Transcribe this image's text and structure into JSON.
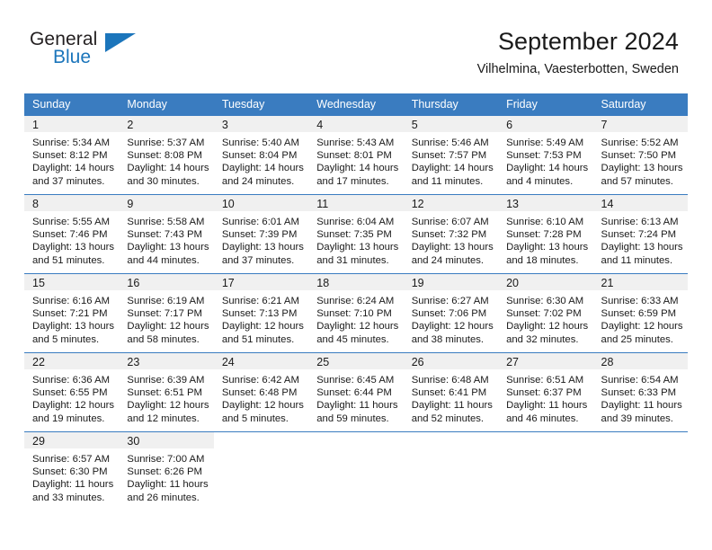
{
  "brand": {
    "name_part1": "General",
    "name_part2": "Blue",
    "logo_icon": "triangle-flag-icon",
    "accent_color": "#1b75bb"
  },
  "header": {
    "month_title": "September 2024",
    "location": "Vilhelmina, Vaesterbotten, Sweden"
  },
  "calendar": {
    "header_bg": "#3a7cc0",
    "daynum_bg": "#f0f0f0",
    "weekday_headers": [
      "Sunday",
      "Monday",
      "Tuesday",
      "Wednesday",
      "Thursday",
      "Friday",
      "Saturday"
    ],
    "weeks": [
      [
        {
          "day": "1",
          "sunrise": "Sunrise: 5:34 AM",
          "sunset": "Sunset: 8:12 PM",
          "daylight_line1": "Daylight: 14 hours",
          "daylight_line2": "and 37 minutes."
        },
        {
          "day": "2",
          "sunrise": "Sunrise: 5:37 AM",
          "sunset": "Sunset: 8:08 PM",
          "daylight_line1": "Daylight: 14 hours",
          "daylight_line2": "and 30 minutes."
        },
        {
          "day": "3",
          "sunrise": "Sunrise: 5:40 AM",
          "sunset": "Sunset: 8:04 PM",
          "daylight_line1": "Daylight: 14 hours",
          "daylight_line2": "and 24 minutes."
        },
        {
          "day": "4",
          "sunrise": "Sunrise: 5:43 AM",
          "sunset": "Sunset: 8:01 PM",
          "daylight_line1": "Daylight: 14 hours",
          "daylight_line2": "and 17 minutes."
        },
        {
          "day": "5",
          "sunrise": "Sunrise: 5:46 AM",
          "sunset": "Sunset: 7:57 PM",
          "daylight_line1": "Daylight: 14 hours",
          "daylight_line2": "and 11 minutes."
        },
        {
          "day": "6",
          "sunrise": "Sunrise: 5:49 AM",
          "sunset": "Sunset: 7:53 PM",
          "daylight_line1": "Daylight: 14 hours",
          "daylight_line2": "and 4 minutes."
        },
        {
          "day": "7",
          "sunrise": "Sunrise: 5:52 AM",
          "sunset": "Sunset: 7:50 PM",
          "daylight_line1": "Daylight: 13 hours",
          "daylight_line2": "and 57 minutes."
        }
      ],
      [
        {
          "day": "8",
          "sunrise": "Sunrise: 5:55 AM",
          "sunset": "Sunset: 7:46 PM",
          "daylight_line1": "Daylight: 13 hours",
          "daylight_line2": "and 51 minutes."
        },
        {
          "day": "9",
          "sunrise": "Sunrise: 5:58 AM",
          "sunset": "Sunset: 7:43 PM",
          "daylight_line1": "Daylight: 13 hours",
          "daylight_line2": "and 44 minutes."
        },
        {
          "day": "10",
          "sunrise": "Sunrise: 6:01 AM",
          "sunset": "Sunset: 7:39 PM",
          "daylight_line1": "Daylight: 13 hours",
          "daylight_line2": "and 37 minutes."
        },
        {
          "day": "11",
          "sunrise": "Sunrise: 6:04 AM",
          "sunset": "Sunset: 7:35 PM",
          "daylight_line1": "Daylight: 13 hours",
          "daylight_line2": "and 31 minutes."
        },
        {
          "day": "12",
          "sunrise": "Sunrise: 6:07 AM",
          "sunset": "Sunset: 7:32 PM",
          "daylight_line1": "Daylight: 13 hours",
          "daylight_line2": "and 24 minutes."
        },
        {
          "day": "13",
          "sunrise": "Sunrise: 6:10 AM",
          "sunset": "Sunset: 7:28 PM",
          "daylight_line1": "Daylight: 13 hours",
          "daylight_line2": "and 18 minutes."
        },
        {
          "day": "14",
          "sunrise": "Sunrise: 6:13 AM",
          "sunset": "Sunset: 7:24 PM",
          "daylight_line1": "Daylight: 13 hours",
          "daylight_line2": "and 11 minutes."
        }
      ],
      [
        {
          "day": "15",
          "sunrise": "Sunrise: 6:16 AM",
          "sunset": "Sunset: 7:21 PM",
          "daylight_line1": "Daylight: 13 hours",
          "daylight_line2": "and 5 minutes."
        },
        {
          "day": "16",
          "sunrise": "Sunrise: 6:19 AM",
          "sunset": "Sunset: 7:17 PM",
          "daylight_line1": "Daylight: 12 hours",
          "daylight_line2": "and 58 minutes."
        },
        {
          "day": "17",
          "sunrise": "Sunrise: 6:21 AM",
          "sunset": "Sunset: 7:13 PM",
          "daylight_line1": "Daylight: 12 hours",
          "daylight_line2": "and 51 minutes."
        },
        {
          "day": "18",
          "sunrise": "Sunrise: 6:24 AM",
          "sunset": "Sunset: 7:10 PM",
          "daylight_line1": "Daylight: 12 hours",
          "daylight_line2": "and 45 minutes."
        },
        {
          "day": "19",
          "sunrise": "Sunrise: 6:27 AM",
          "sunset": "Sunset: 7:06 PM",
          "daylight_line1": "Daylight: 12 hours",
          "daylight_line2": "and 38 minutes."
        },
        {
          "day": "20",
          "sunrise": "Sunrise: 6:30 AM",
          "sunset": "Sunset: 7:02 PM",
          "daylight_line1": "Daylight: 12 hours",
          "daylight_line2": "and 32 minutes."
        },
        {
          "day": "21",
          "sunrise": "Sunrise: 6:33 AM",
          "sunset": "Sunset: 6:59 PM",
          "daylight_line1": "Daylight: 12 hours",
          "daylight_line2": "and 25 minutes."
        }
      ],
      [
        {
          "day": "22",
          "sunrise": "Sunrise: 6:36 AM",
          "sunset": "Sunset: 6:55 PM",
          "daylight_line1": "Daylight: 12 hours",
          "daylight_line2": "and 19 minutes."
        },
        {
          "day": "23",
          "sunrise": "Sunrise: 6:39 AM",
          "sunset": "Sunset: 6:51 PM",
          "daylight_line1": "Daylight: 12 hours",
          "daylight_line2": "and 12 minutes."
        },
        {
          "day": "24",
          "sunrise": "Sunrise: 6:42 AM",
          "sunset": "Sunset: 6:48 PM",
          "daylight_line1": "Daylight: 12 hours",
          "daylight_line2": "and 5 minutes."
        },
        {
          "day": "25",
          "sunrise": "Sunrise: 6:45 AM",
          "sunset": "Sunset: 6:44 PM",
          "daylight_line1": "Daylight: 11 hours",
          "daylight_line2": "and 59 minutes."
        },
        {
          "day": "26",
          "sunrise": "Sunrise: 6:48 AM",
          "sunset": "Sunset: 6:41 PM",
          "daylight_line1": "Daylight: 11 hours",
          "daylight_line2": "and 52 minutes."
        },
        {
          "day": "27",
          "sunrise": "Sunrise: 6:51 AM",
          "sunset": "Sunset: 6:37 PM",
          "daylight_line1": "Daylight: 11 hours",
          "daylight_line2": "and 46 minutes."
        },
        {
          "day": "28",
          "sunrise": "Sunrise: 6:54 AM",
          "sunset": "Sunset: 6:33 PM",
          "daylight_line1": "Daylight: 11 hours",
          "daylight_line2": "and 39 minutes."
        }
      ],
      [
        {
          "day": "29",
          "sunrise": "Sunrise: 6:57 AM",
          "sunset": "Sunset: 6:30 PM",
          "daylight_line1": "Daylight: 11 hours",
          "daylight_line2": "and 33 minutes."
        },
        {
          "day": "30",
          "sunrise": "Sunrise: 7:00 AM",
          "sunset": "Sunset: 6:26 PM",
          "daylight_line1": "Daylight: 11 hours",
          "daylight_line2": "and 26 minutes."
        },
        {
          "day": "",
          "sunrise": "",
          "sunset": "",
          "daylight_line1": "",
          "daylight_line2": ""
        },
        {
          "day": "",
          "sunrise": "",
          "sunset": "",
          "daylight_line1": "",
          "daylight_line2": ""
        },
        {
          "day": "",
          "sunrise": "",
          "sunset": "",
          "daylight_line1": "",
          "daylight_line2": ""
        },
        {
          "day": "",
          "sunrise": "",
          "sunset": "",
          "daylight_line1": "",
          "daylight_line2": ""
        },
        {
          "day": "",
          "sunrise": "",
          "sunset": "",
          "daylight_line1": "",
          "daylight_line2": ""
        }
      ]
    ]
  }
}
